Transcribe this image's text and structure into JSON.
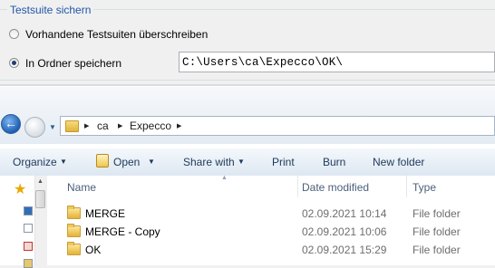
{
  "dialog": {
    "group_title": "Testsuite sichern",
    "options": [
      {
        "label": "Vorhandene Testsuiten überschreiben",
        "checked": false
      },
      {
        "label": "In Ordner speichern",
        "checked": true
      }
    ],
    "folder_path": "C:\\Users\\ca\\Expecco\\OK\\"
  },
  "explorer": {
    "breadcrumb": [
      "ca",
      "Expecco"
    ],
    "toolbar": {
      "organize": "Organize",
      "open": "Open",
      "share_with": "Share with",
      "print": "Print",
      "burn": "Burn",
      "new_folder": "New folder"
    },
    "columns": {
      "name": "Name",
      "date": "Date modified",
      "type": "Type"
    },
    "rows": [
      {
        "name": "MERGE",
        "date": "02.09.2021 10:14",
        "type": "File folder"
      },
      {
        "name": "MERGE - Copy",
        "date": "02.09.2021 10:06",
        "type": "File folder"
      },
      {
        "name": "OK",
        "date": "02.09.2021 15:29",
        "type": "File folder"
      }
    ]
  },
  "icons": [
    "favorites-star-icon",
    "folder-icon",
    "back-arrow-icon",
    "forward-arrow-icon",
    "open-file-icon"
  ]
}
